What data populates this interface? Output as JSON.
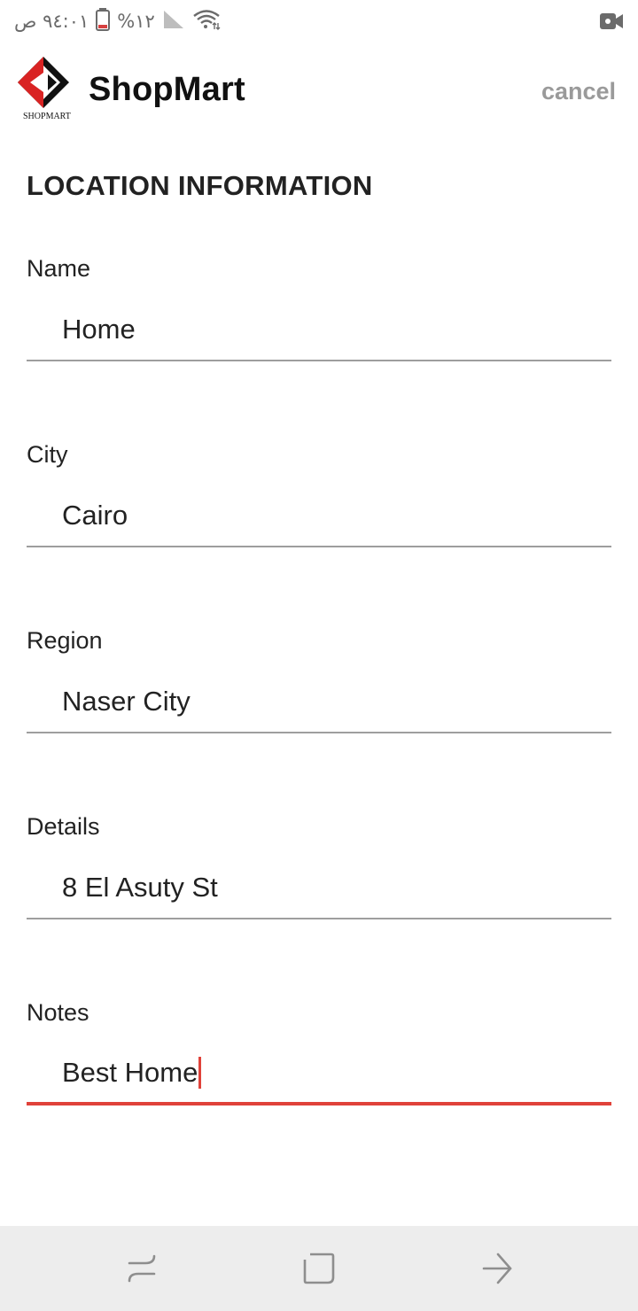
{
  "status_bar": {
    "time": "١٠:٤٩ ص",
    "battery_percent": "%١٢",
    "icons": [
      "battery-icon",
      "signal-icon",
      "wifi-icon",
      "video-record-icon"
    ]
  },
  "header": {
    "brand": "ShopMart",
    "logo_text": "SHOPMART",
    "cancel_label": "cancel"
  },
  "section": {
    "title": "LOCATION INFORMATION"
  },
  "fields": [
    {
      "label": "Name",
      "value": "Home"
    },
    {
      "label": "City",
      "value": "Cairo"
    },
    {
      "label": "Region",
      "value": "Naser City"
    },
    {
      "label": "Details",
      "value": "8 El Asuty St"
    },
    {
      "label": "Notes",
      "value": "Best Home"
    }
  ],
  "colors": {
    "accent": "#e0423a",
    "underline": "#9e9e9e",
    "muted": "#9a9a9a",
    "navbar": "#ededed"
  },
  "navbar": {
    "icons": [
      "recent-apps-icon",
      "home-icon",
      "back-icon"
    ]
  }
}
